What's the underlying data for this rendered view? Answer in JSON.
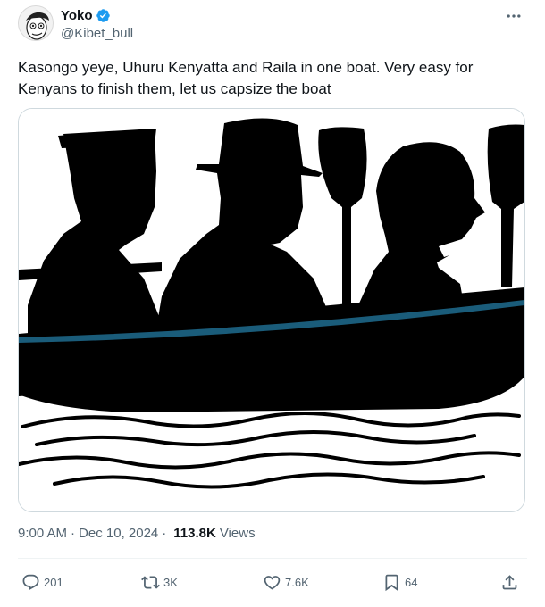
{
  "user": {
    "display_name": "Yoko",
    "handle": "@Kibet_bull",
    "verified": true,
    "verified_color": "#1d9bf0"
  },
  "tweet": {
    "text": "Kasongo yeye, Uhuru Kenyatta and Raila in one boat. Very easy for Kenyans to finish them, let us capsize the boat",
    "media_icon": "silhouette-boat-image"
  },
  "meta": {
    "time": "9:00 AM",
    "date": "Dec 10, 2024",
    "separator": "·",
    "views_count": "113.8K",
    "views_label": "Views"
  },
  "actions": {
    "replies": "201",
    "reposts": "3K",
    "likes": "7.6K",
    "bookmarks": "64"
  },
  "colors": {
    "text": "#0f1419",
    "secondary": "#536471",
    "stripe": "#1a5c7a"
  }
}
